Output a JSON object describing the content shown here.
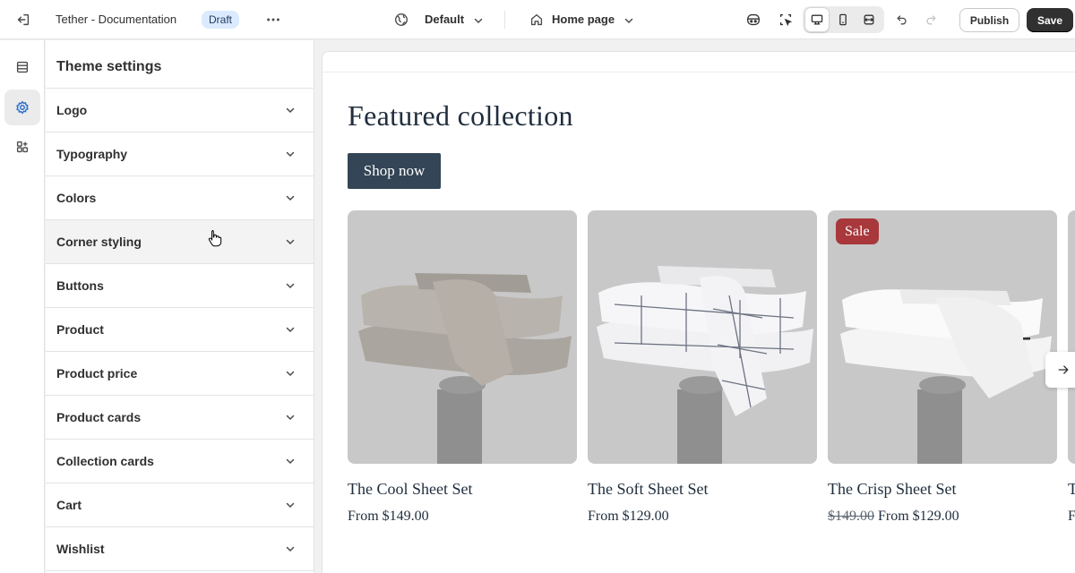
{
  "topbar": {
    "store_name": "Tether - Documentation",
    "status_badge": "Draft",
    "theme_select": "Default",
    "page_select": "Home page",
    "publish_label": "Publish",
    "save_label": "Save",
    "icons": [
      "exit-icon",
      "more-icon",
      "globe-icon",
      "chevron-down-icon",
      "home-icon",
      "ai-assistant-icon",
      "inspector-icon",
      "desktop-icon",
      "mobile-icon",
      "fullwidth-icon",
      "undo-icon",
      "redo-icon"
    ]
  },
  "rail": {
    "items": [
      {
        "icon": "sections-icon",
        "active": false
      },
      {
        "icon": "settings-icon",
        "active": true
      },
      {
        "icon": "apps-icon",
        "active": false
      }
    ]
  },
  "panel": {
    "title": "Theme settings",
    "items": [
      {
        "label": "Logo"
      },
      {
        "label": "Typography"
      },
      {
        "label": "Colors"
      },
      {
        "label": "Corner styling"
      },
      {
        "label": "Buttons"
      },
      {
        "label": "Product"
      },
      {
        "label": "Product price"
      },
      {
        "label": "Product cards"
      },
      {
        "label": "Collection cards"
      },
      {
        "label": "Cart"
      },
      {
        "label": "Wishlist"
      }
    ]
  },
  "preview": {
    "section_title": "Featured collection",
    "cta_label": "Shop now",
    "products": [
      {
        "name": "The Cool Sheet Set",
        "price": "From $149.00",
        "compare_price": "",
        "badge": ""
      },
      {
        "name": "The Soft Sheet Set",
        "price": "From $129.00",
        "compare_price": "",
        "badge": ""
      },
      {
        "name": "The Crisp Sheet Set",
        "price": "From $129.00",
        "compare_price": "$149.00",
        "badge": "Sale"
      }
    ],
    "partial_product": {
      "name": "T",
      "price": "F"
    }
  },
  "colors": {
    "accent_dark": "#303030",
    "draft_badge_bg": "#dbeafe",
    "button_navy": "#334556",
    "sale_red": "#a8383b",
    "heading_text": "#1f2d3d"
  }
}
